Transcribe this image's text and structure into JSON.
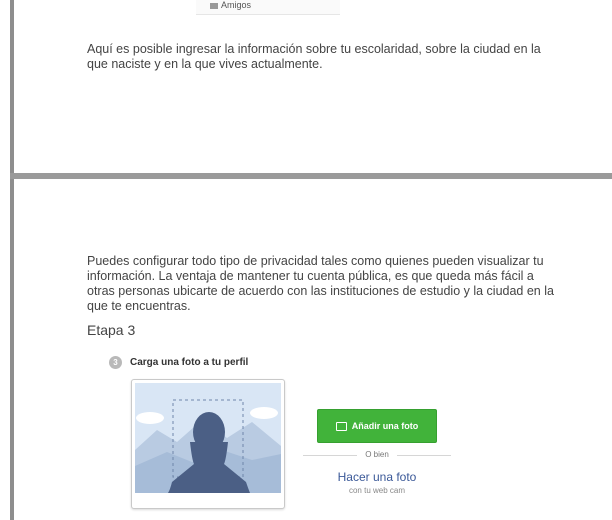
{
  "top_snippet": {
    "label": "Amigos"
  },
  "section1": {
    "paragraph": "Aquí es posible ingresar la información sobre tu escolaridad, sobre la ciudad en la que naciste y en la que vives actualmente."
  },
  "section2": {
    "paragraph": "Puedes configurar todo tipo de privacidad tales como quienes pueden visualizar tu información. La ventaja de mantener tu cuenta pública, es que queda más fácil a otras personas ubicarte de acuerdo con las instituciones de estudio y la ciudad en la que te encuentras.",
    "stage_title": "Etapa 3",
    "step_number": "3",
    "step_label": "Carga una foto a tu perfil",
    "add_photo_label": "Añadir una foto",
    "or_label": "O bien",
    "take_photo_label": "Hacer una foto",
    "webcam_label": "con tu web cam"
  },
  "colors": {
    "accent_green": "#41b33a",
    "link_blue": "#3b5998",
    "avatar_fill": "#4b5f85",
    "divider": "#9a9a9a"
  }
}
